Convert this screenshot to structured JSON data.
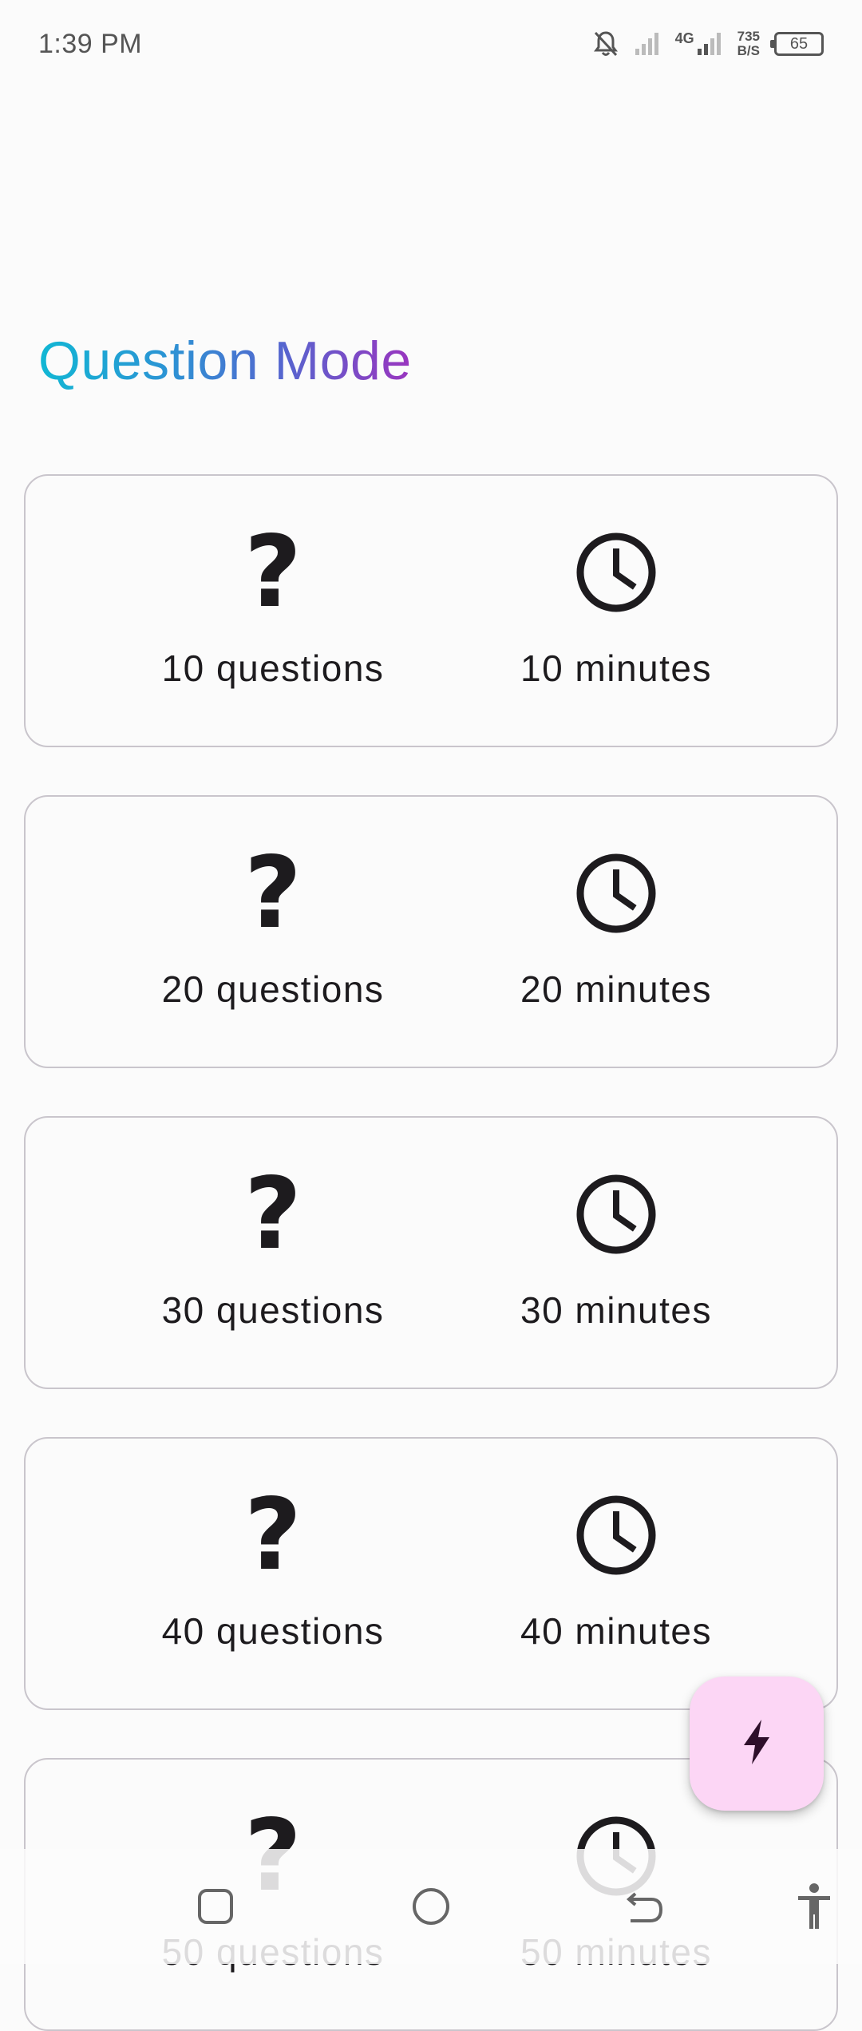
{
  "status_bar": {
    "time": "1:39 PM",
    "network": "4G",
    "speed_value": "735",
    "speed_unit": "B/S",
    "battery": "65"
  },
  "page": {
    "title": "Question Mode"
  },
  "modes": [
    {
      "questions_label": "10 questions",
      "minutes_label": "10 minutes"
    },
    {
      "questions_label": "20 questions",
      "minutes_label": "20 minutes"
    },
    {
      "questions_label": "30 questions",
      "minutes_label": "30 minutes"
    },
    {
      "questions_label": "40 questions",
      "minutes_label": "40 minutes"
    },
    {
      "questions_label": "50 questions",
      "minutes_label": "50 minutes"
    }
  ],
  "icons": {
    "question": "question-mark-icon",
    "clock": "clock-icon",
    "fab": "lightning-bolt-icon",
    "nav_recents": "square-recents-icon",
    "nav_home": "circle-home-icon",
    "nav_back": "back-arrow-icon",
    "nav_accessibility": "accessibility-icon"
  },
  "colors": {
    "title_gradient_start": "#11b7d4",
    "title_gradient_end": "#9a35bf",
    "fab_background": "#fcd6f5",
    "card_border": "#c9c5cc"
  }
}
